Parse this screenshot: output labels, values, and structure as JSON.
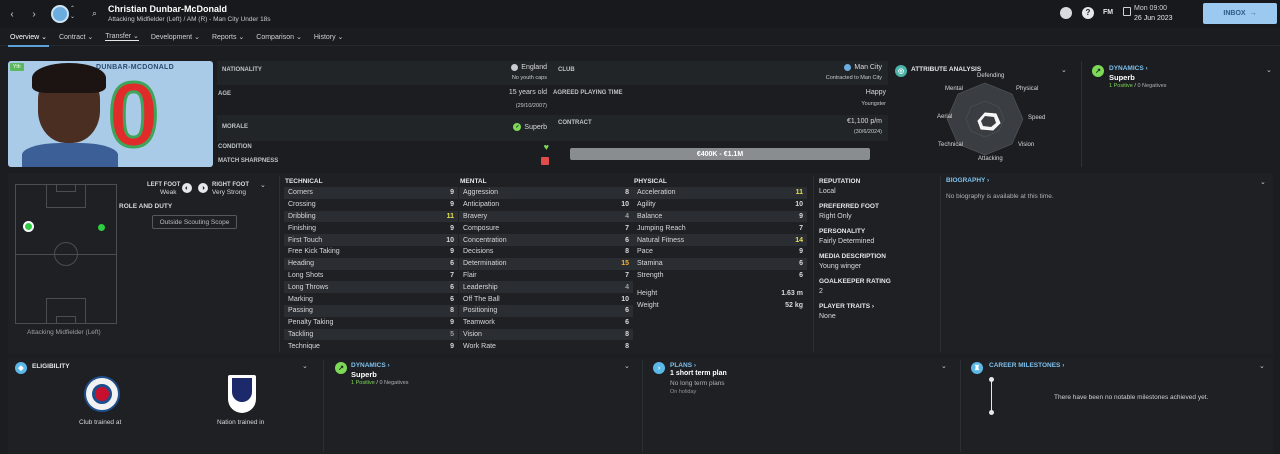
{
  "header": {
    "player_name": "Christian Dunbar-McDonald",
    "player_subtitle": "Attacking Midfielder (Left) / AM (R) - Man City Under 18s",
    "date_day": "Mon 09:00",
    "date": "26 Jun 2023",
    "fm": "FM",
    "inbox": "INBOX"
  },
  "tabs": [
    {
      "label": "Overview ⌄"
    },
    {
      "label": "Contract ⌄"
    },
    {
      "label": "Transfer ⌄"
    },
    {
      "label": "Development ⌄"
    },
    {
      "label": "Reports ⌄"
    },
    {
      "label": "Comparison ⌄"
    },
    {
      "label": "History ⌄"
    }
  ],
  "profile": {
    "shirt_name": "DUNBAR-MCDONALD",
    "shirt_number": "0",
    "badge": "Yth",
    "nationality_label": "NATIONALITY",
    "nationality": "England",
    "youth_caps": "No youth caps",
    "age_label": "AGE",
    "age": "15 years old",
    "dob": "(29/10/2007)",
    "morale_label": "MORALE",
    "morale": "Superb",
    "condition_label": "CONDITION",
    "sharpness_label": "MATCH SHARPNESS",
    "club_label": "CLUB",
    "club": "Man City",
    "contracted": "Contracted to Man City",
    "playing_time_label": "AGREED PLAYING TIME",
    "playing_time": "Happy",
    "playing_time_role": "Youngster",
    "contract_label": "CONTRACT",
    "wage": "€1,100 p/m",
    "contract_end": "(30/6/2024)",
    "value": "€400K - €1.1M"
  },
  "attribute_analysis": {
    "title": "ATTRIBUTE ANALYSIS",
    "labels": {
      "top": "Defending",
      "tr": "Physical",
      "r": "Speed",
      "br": "Vision",
      "bottom": "Attacking",
      "bl": "Technical",
      "l": "Aerial",
      "tl": "Mental"
    }
  },
  "dynamics_top": {
    "title": "DYNAMICS ›",
    "value": "Superb",
    "positive": "1 Positive",
    "sep": "/",
    "negative": "0 Negatives"
  },
  "position": {
    "left_foot_label": "LEFT FOOT",
    "left_foot": "Weak",
    "right_foot_label": "RIGHT FOOT",
    "right_foot": "Very Strong",
    "role_label": "ROLE AND DUTY",
    "scope_button": "Outside Scouting Scope",
    "position_name": "Attacking Midfielder (Left)"
  },
  "technical": {
    "title": "TECHNICAL",
    "rows": [
      {
        "name": "Corners",
        "value": "9"
      },
      {
        "name": "Crossing",
        "value": "9"
      },
      {
        "name": "Dribbling",
        "value": "11"
      },
      {
        "name": "Finishing",
        "value": "9"
      },
      {
        "name": "First Touch",
        "value": "10"
      },
      {
        "name": "Free Kick Taking",
        "value": "9"
      },
      {
        "name": "Heading",
        "value": "6"
      },
      {
        "name": "Long Shots",
        "value": "7"
      },
      {
        "name": "Long Throws",
        "value": "6"
      },
      {
        "name": "Marking",
        "value": "6"
      },
      {
        "name": "Passing",
        "value": "8"
      },
      {
        "name": "Penalty Taking",
        "value": "9"
      },
      {
        "name": "Tackling",
        "value": "5"
      },
      {
        "name": "Technique",
        "value": "9"
      }
    ]
  },
  "mental": {
    "title": "MENTAL",
    "rows": [
      {
        "name": "Aggression",
        "value": "8"
      },
      {
        "name": "Anticipation",
        "value": "10"
      },
      {
        "name": "Bravery",
        "value": "4"
      },
      {
        "name": "Composure",
        "value": "7"
      },
      {
        "name": "Concentration",
        "value": "6"
      },
      {
        "name": "Decisions",
        "value": "8"
      },
      {
        "name": "Determination",
        "value": "15"
      },
      {
        "name": "Flair",
        "value": "7"
      },
      {
        "name": "Leadership",
        "value": "4"
      },
      {
        "name": "Off The Ball",
        "value": "10"
      },
      {
        "name": "Positioning",
        "value": "6"
      },
      {
        "name": "Teamwork",
        "value": "6"
      },
      {
        "name": "Vision",
        "value": "8"
      },
      {
        "name": "Work Rate",
        "value": "8"
      }
    ]
  },
  "physical": {
    "title": "PHYSICAL",
    "rows": [
      {
        "name": "Acceleration",
        "value": "11"
      },
      {
        "name": "Agility",
        "value": "10"
      },
      {
        "name": "Balance",
        "value": "9"
      },
      {
        "name": "Jumping Reach",
        "value": "7"
      },
      {
        "name": "Natural Fitness",
        "value": "14"
      },
      {
        "name": "Pace",
        "value": "9"
      },
      {
        "name": "Stamina",
        "value": "6"
      },
      {
        "name": "Strength",
        "value": "6"
      }
    ],
    "height_label": "Height",
    "height": "1.63 m",
    "weight_label": "Weight",
    "weight": "52 kg"
  },
  "info": {
    "reputation_label": "REPUTATION",
    "reputation": "Local",
    "foot_label": "PREFERRED FOOT",
    "foot": "Right Only",
    "personality_label": "PERSONALITY",
    "personality": "Fairly Determined",
    "media_label": "MEDIA DESCRIPTION",
    "media": "Young winger",
    "gk_label": "GOALKEEPER RATING",
    "gk": "2",
    "traits_label": "PLAYER TRAITS ›",
    "traits": "None"
  },
  "biography": {
    "title": "BIOGRAPHY ›",
    "text": "No biography is available at this time."
  },
  "eligibility": {
    "title": "ELIGIBILITY",
    "club_trained": "Club trained at",
    "nation_trained": "Nation trained in"
  },
  "dynamics_bottom": {
    "title": "DYNAMICS ›",
    "value": "Superb",
    "positive": "1 Positive",
    "sep": "/",
    "negative": "0 Negatives"
  },
  "plans": {
    "title": "PLANS ›",
    "short": "1 short term plan",
    "long": "No long term plans",
    "status": "On holiday"
  },
  "milestones": {
    "title": "CAREER MILESTONES ›",
    "text": "There have been no notable milestones achieved yet."
  },
  "colors": {
    "accent": "#5ea1d8",
    "highlight": "#e6e255",
    "positive": "#7ed957",
    "negative": "#e04b4b",
    "inbox": "#9cc9ef"
  }
}
